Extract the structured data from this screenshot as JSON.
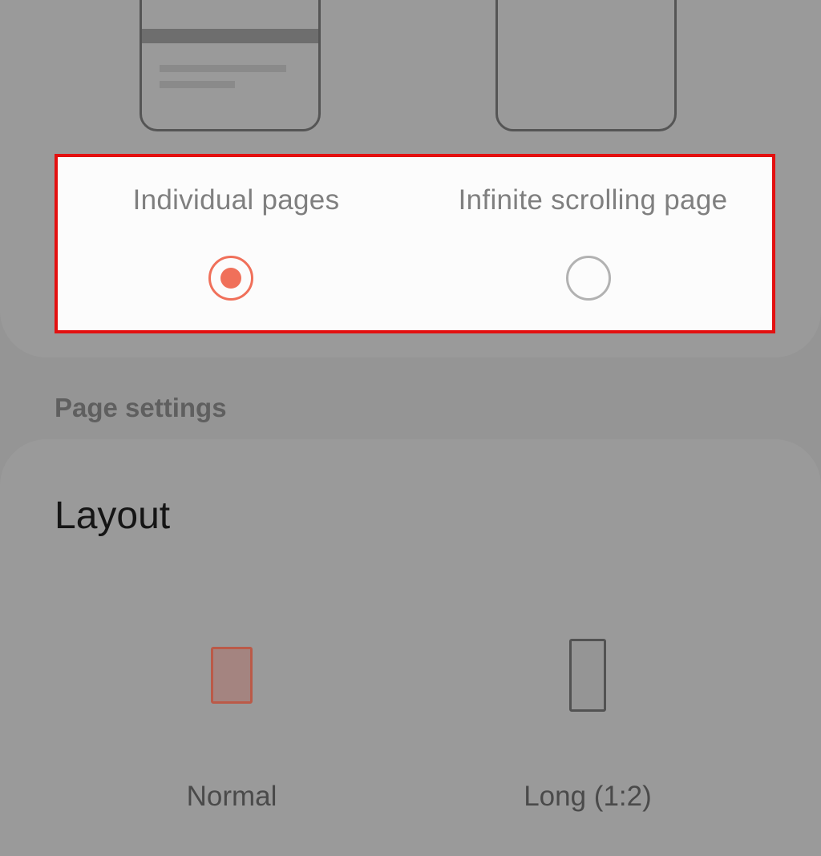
{
  "page_style": {
    "options": [
      {
        "label": "Individual pages",
        "selected": true
      },
      {
        "label": "Infinite scrolling page",
        "selected": false
      }
    ]
  },
  "page_settings": {
    "section_title": "Page settings",
    "layout": {
      "title": "Layout",
      "options": [
        {
          "label": "Normal",
          "selected": true
        },
        {
          "label": "Long (1:2)",
          "selected": false
        }
      ]
    }
  },
  "colors": {
    "accent": "#f0705a",
    "highlight_border": "#e31010"
  }
}
